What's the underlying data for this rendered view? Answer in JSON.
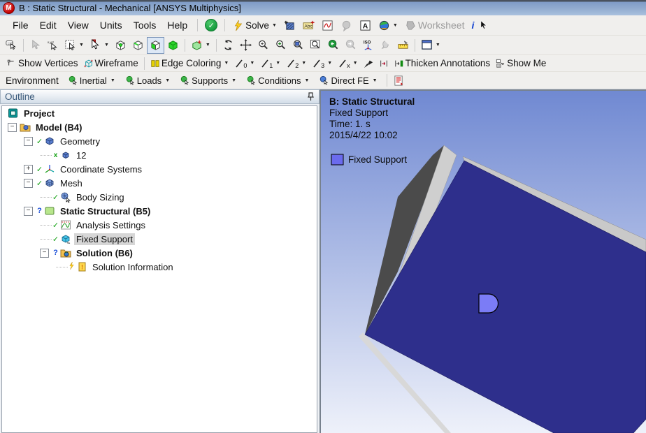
{
  "window": {
    "title": "B : Static Structural - Mechanical [ANSYS Multiphysics]",
    "app_icon": "M"
  },
  "menubar": {
    "items": [
      "File",
      "Edit",
      "View",
      "Units",
      "Tools",
      "Help"
    ],
    "solve_label": "Solve",
    "worksheet_label": "Worksheet",
    "info_glyph": "i"
  },
  "display_bar": {
    "show_vertices": "Show Vertices",
    "wireframe": "Wireframe",
    "edge_coloring": "Edge Coloring",
    "pens": [
      "0",
      "1",
      "2",
      "3",
      "x"
    ],
    "thicken": "Thicken Annotations",
    "show_me": "Show Me"
  },
  "environment_bar": {
    "label": "Environment",
    "buttons": [
      "Inertial",
      "Loads",
      "Supports",
      "Conditions",
      "Direct FE"
    ]
  },
  "outline": {
    "title": "Outline",
    "tree": [
      {
        "label": "Project",
        "level": 0,
        "icon": "project-icon",
        "bold": true
      },
      {
        "label": "Model (B4)",
        "level": 1,
        "expander": "minus",
        "icon": "model-icon",
        "bold": true
      },
      {
        "label": "Geometry",
        "level": 2,
        "expander": "minus",
        "state": "check",
        "icon": "geometry-icon"
      },
      {
        "label": "12",
        "level": 3,
        "state": "x",
        "icon": "body-icon"
      },
      {
        "label": "Coordinate Systems",
        "level": 2,
        "expander": "plus",
        "state": "check",
        "icon": "coordinate-systems-icon"
      },
      {
        "label": "Mesh",
        "level": 2,
        "expander": "minus",
        "state": "check",
        "icon": "mesh-icon"
      },
      {
        "label": "Body Sizing",
        "level": 3,
        "state": "check",
        "icon": "body-sizing-icon"
      },
      {
        "label": "Static Structural (B5)",
        "level": 2,
        "expander": "minus",
        "state": "question",
        "icon": "static-structural-icon",
        "bold": true
      },
      {
        "label": "Analysis Settings",
        "level": 3,
        "state": "check",
        "icon": "analysis-settings-icon"
      },
      {
        "label": "Fixed Support",
        "level": 3,
        "state": "check",
        "icon": "fixed-support-icon",
        "selected": true
      },
      {
        "label": "Solution (B6)",
        "level": 3,
        "expander": "minus",
        "state": "question",
        "icon": "solution-icon",
        "bold": true
      },
      {
        "label": "Solution Information",
        "level": 4,
        "state": "lightning",
        "icon": "solution-information-icon"
      }
    ]
  },
  "viewport": {
    "annotation": [
      "B: Static Structural",
      "Fixed Support",
      "Time: 1. s",
      "2015/4/22 10:02"
    ],
    "legend_label": "Fixed Support",
    "colors": {
      "bg_top": "#7089d2",
      "bg_bottom": "#eef1fa",
      "plate": "#2e2f8c",
      "plate_edge": "#c9c9c9",
      "side_dark": "#4b4b4b",
      "side_light": "#cfcfcf",
      "bottom_sliver": "#d8d8d8",
      "marker": "#7b7cf6",
      "legend_fill": "#6b6bee"
    }
  },
  "icons": {
    "caret": "▼",
    "minus": "−",
    "plus": "+",
    "check": "✓",
    "hidden_x": "x",
    "question": "?"
  }
}
